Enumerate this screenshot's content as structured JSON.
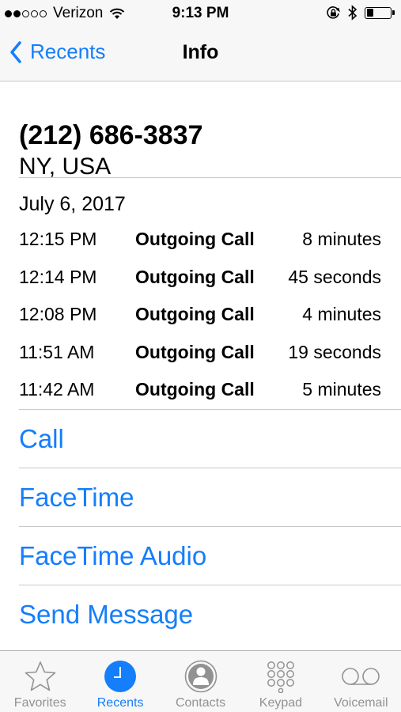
{
  "status_bar": {
    "carrier": "Verizon",
    "time": "9:13 PM",
    "signal_filled": 2,
    "signal_total": 5,
    "battery_level": 0.3
  },
  "nav": {
    "back_label": "Recents",
    "title": "Info"
  },
  "contact": {
    "phone_number": "(212) 686-3837",
    "location": "NY, USA"
  },
  "calls": {
    "date": "July 6, 2017",
    "rows": [
      {
        "time": "12:15 PM",
        "type": "Outgoing Call",
        "duration": "8 minutes"
      },
      {
        "time": "12:14 PM",
        "type": "Outgoing Call",
        "duration": "45 seconds"
      },
      {
        "time": "12:08 PM",
        "type": "Outgoing Call",
        "duration": "4 minutes"
      },
      {
        "time": "11:51 AM",
        "type": "Outgoing Call",
        "duration": "19 seconds"
      },
      {
        "time": "11:42 AM",
        "type": "Outgoing Call",
        "duration": "5 minutes"
      }
    ]
  },
  "actions": [
    "Call",
    "FaceTime",
    "FaceTime Audio",
    "Send Message"
  ],
  "tabs": [
    {
      "label": "Favorites",
      "icon": "star-icon",
      "active": false
    },
    {
      "label": "Recents",
      "icon": "clock-icon",
      "active": true
    },
    {
      "label": "Contacts",
      "icon": "person-icon",
      "active": false
    },
    {
      "label": "Keypad",
      "icon": "keypad-icon",
      "active": false
    },
    {
      "label": "Voicemail",
      "icon": "voicemail-icon",
      "active": false
    }
  ],
  "colors": {
    "accent": "#147efb",
    "tab_inactive": "#929292",
    "separator": "#c8c7cc",
    "bar_background": "#f7f7f7"
  }
}
